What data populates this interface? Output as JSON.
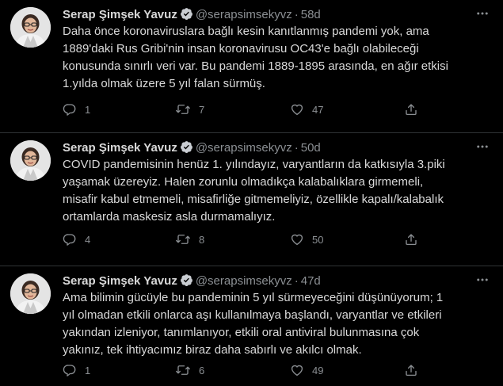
{
  "colors": {
    "background": "#000000",
    "text": "#d9d9d9",
    "muted": "#8b8f93",
    "verified": "#c9cdd2"
  },
  "tweets": [
    {
      "name": "Serap Şimşek Yavuz",
      "handle": "@serapsimsekyvz",
      "dot": "·",
      "age": "58d",
      "lines": [
        "Daha önce koronaviruslara bağlı kesin kanıtlanmış pandemi yok, ama",
        "1889'daki  Rus Gribi'nin  insan koronavirusu OC43'e bağlı olabileceği",
        "konusunda sınırlı veri var. Bu pandemi 1889-1895 arasında, en ağır etkisi",
        "1.yılda olmak üzere 5 yıl falan sürmüş."
      ],
      "replies": "1",
      "retweets": "7",
      "likes": "47"
    },
    {
      "name": "Serap Şimşek Yavuz",
      "handle": "@serapsimsekyvz",
      "dot": "·",
      "age": "50d",
      "lines": [
        "COVID pandemisinin henüz 1. yılındayız, varyantların da katkısıyla 3.piki",
        "yaşamak üzereyiz. Halen zorunlu olmadıkça kalabalıklara girmemeli,",
        "misafir kabul etmemeli, misafirliğe gitmemeliyiz, özellikle kapalı/kalabalık",
        "ortamlarda maskesiz asla durmamalıyız."
      ],
      "replies": "4",
      "retweets": "8",
      "likes": "50"
    },
    {
      "name": "Serap Şimşek Yavuz",
      "handle": "@serapsimsekyvz",
      "dot": "·",
      "age": "47d",
      "lines": [
        "Ama bilimin gücüyle bu pandeminin 5 yıl sürmeyeceğini düşünüyorum;  1",
        "yıl olmadan etkili onlarca aşı kullanılmaya başlandı, varyantlar ve etkileri",
        "yakından izleniyor, tanımlanıyor, etkili oral antiviral bulunmasına çok",
        "yakınız, tek ihtiyacımız biraz daha sabırlı ve akılcı olmak."
      ],
      "replies": "1",
      "retweets": "6",
      "likes": "49"
    }
  ],
  "icons": {
    "avatar": "profile-photo",
    "verified": "verified-badge-icon",
    "more": "more-options-icon",
    "reply": "reply-icon",
    "retweet": "retweet-icon",
    "like": "like-icon",
    "share": "share-icon"
  }
}
